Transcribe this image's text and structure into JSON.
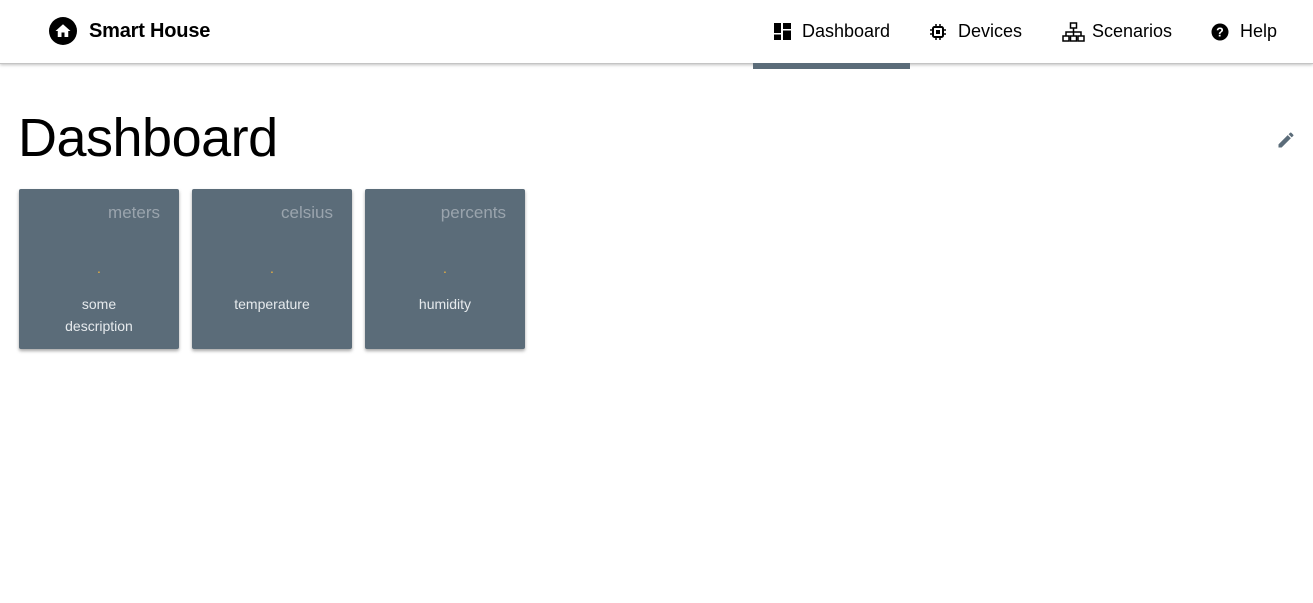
{
  "app": {
    "title": "Smart House",
    "logo_icon": "house-icon"
  },
  "nav": {
    "tabs": [
      {
        "label": "Dashboard",
        "icon": "dashboard-icon",
        "active": true
      },
      {
        "label": "Devices",
        "icon": "chip-icon",
        "active": false
      },
      {
        "label": "Scenarios",
        "icon": "sitemap-icon",
        "active": false
      },
      {
        "label": "Help",
        "icon": "help-circle-icon",
        "active": false
      }
    ]
  },
  "page": {
    "title": "Dashboard",
    "edit_icon": "pencil-icon"
  },
  "widgets": [
    {
      "unit": "meters",
      "value": ".",
      "description": "some description"
    },
    {
      "unit": "celsius",
      "value": ".",
      "description": "temperature"
    },
    {
      "unit": "percents",
      "value": ".",
      "description": "humidity"
    }
  ],
  "colors": {
    "accent": "#5b6c79",
    "value": "#f0b43c",
    "unit": "#9aa4ad"
  }
}
